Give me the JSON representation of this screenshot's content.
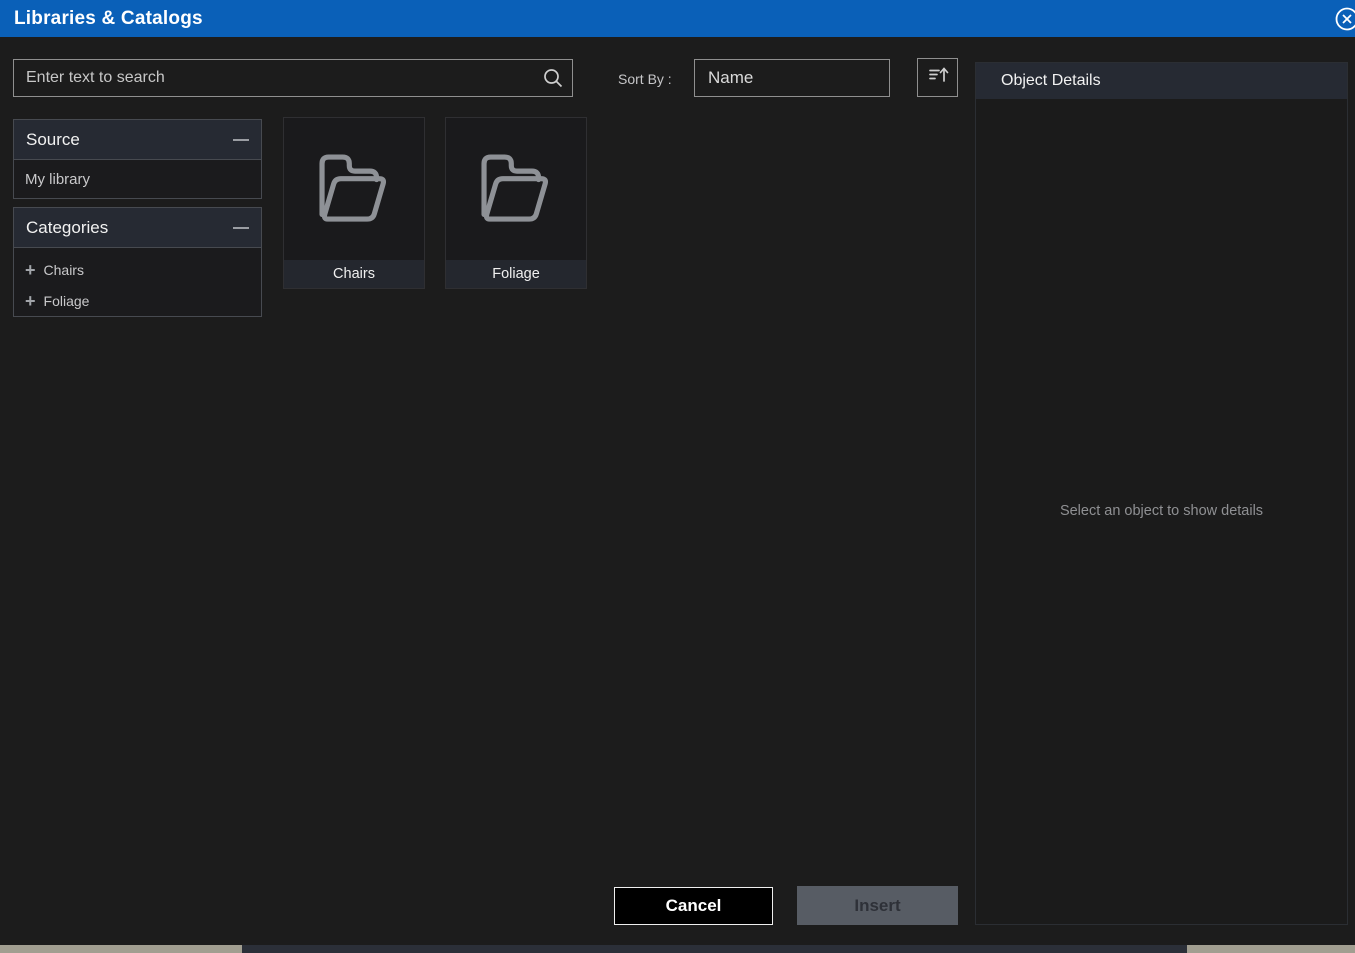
{
  "window": {
    "title": "Libraries & Catalogs",
    "close_icon": "circled-x"
  },
  "toolbar": {
    "search": {
      "placeholder": "Enter text to search",
      "icon": "search-icon"
    },
    "sort_by_label": "Sort By :",
    "sort_value": "Name",
    "sort_order_icon": "sort-amount-up-icon"
  },
  "sidebar": {
    "sections": [
      {
        "title": "Source",
        "collapse_icon": "minus-icon",
        "items": [
          {
            "label": "My library"
          }
        ]
      },
      {
        "title": "Categories",
        "collapse_icon": "minus-icon",
        "items": [
          {
            "label": "Chairs"
          },
          {
            "label": "Foliage"
          }
        ]
      }
    ]
  },
  "content": {
    "folders": [
      {
        "label": "Chairs",
        "icon": "open-folder-icon"
      },
      {
        "label": "Foliage",
        "icon": "open-folder-icon"
      }
    ]
  },
  "details_panel": {
    "title": "Object Details",
    "empty_message": "Select an object to show details"
  },
  "footer": {
    "cancel_label": "Cancel",
    "insert_label": "Insert",
    "insert_enabled": false
  },
  "colors": {
    "titlebar": "#0a60b8",
    "dialog_bg": "#1c1c1c",
    "panel_header_bg": "#262a33",
    "tile_label_bg": "#24272e",
    "border_light": "#8f8f8f",
    "folder_icon_stroke": "#8e9196",
    "disabled_button_bg": "#575c64",
    "underlying_app_beige": "#a19e90",
    "underlying_app_dark": "#2b2f38"
  }
}
